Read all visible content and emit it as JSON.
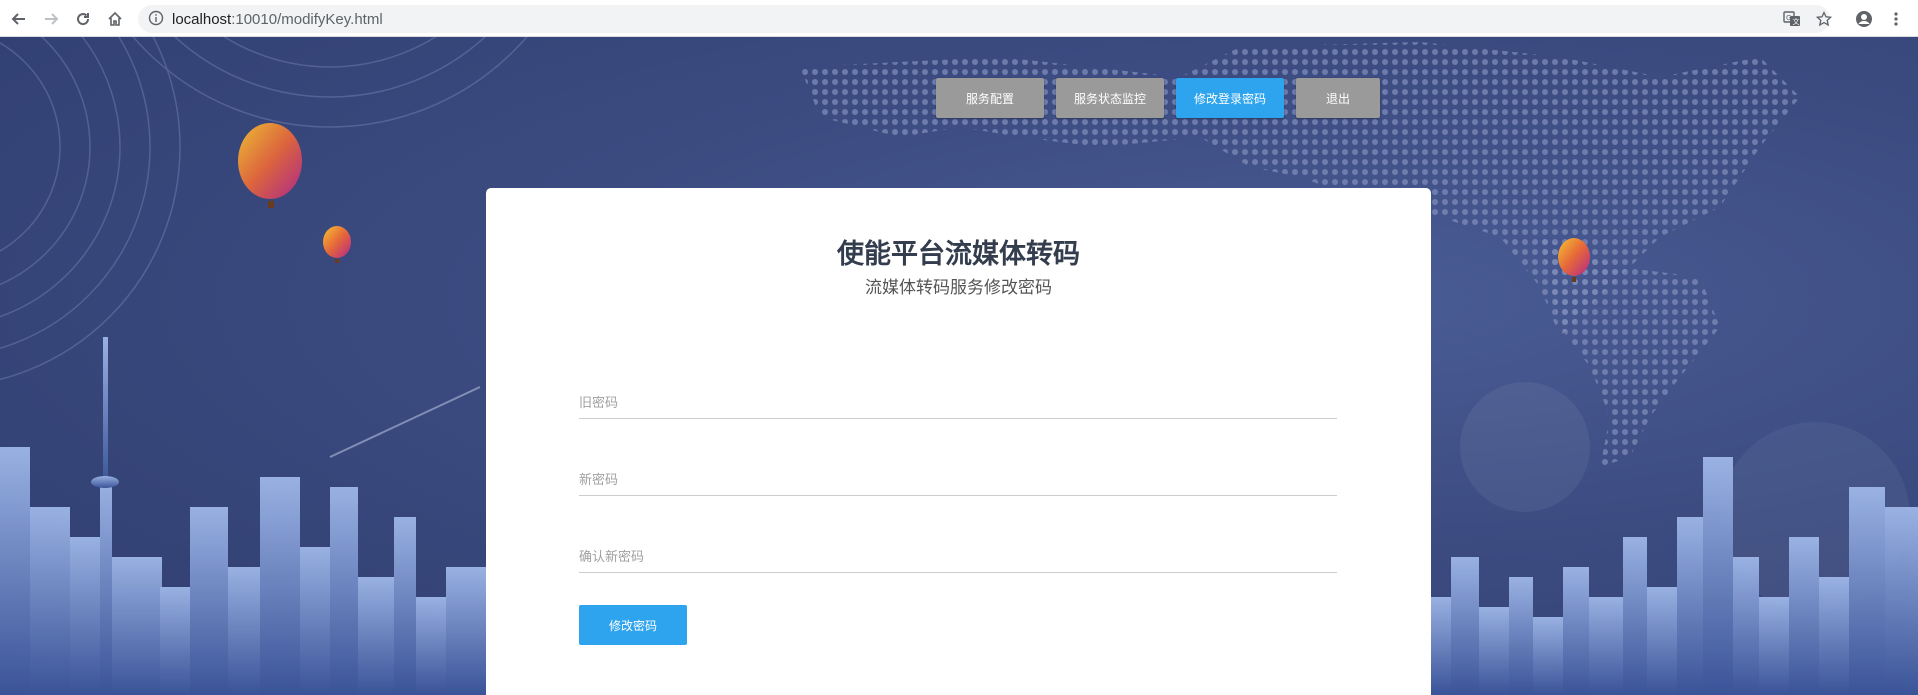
{
  "browser": {
    "url_host": "localhost",
    "url_path": ":10010/modifyKey.html"
  },
  "nav": {
    "items": [
      {
        "label": "服务配置",
        "active": false
      },
      {
        "label": "服务状态监控",
        "active": false
      },
      {
        "label": "修改登录密码",
        "active": true
      },
      {
        "label": "退出",
        "active": false
      }
    ]
  },
  "card": {
    "title": "使能平台流媒体转码",
    "subtitle": "流媒体转码服务修改密码",
    "old_password_placeholder": "旧密码",
    "new_password_placeholder": "新密码",
    "confirm_password_placeholder": "确认新密码",
    "submit_label": "修改密码"
  },
  "colors": {
    "accent": "#2ea3ee",
    "nav_inactive": "#9a9a9a",
    "background": "#3b4b80"
  }
}
